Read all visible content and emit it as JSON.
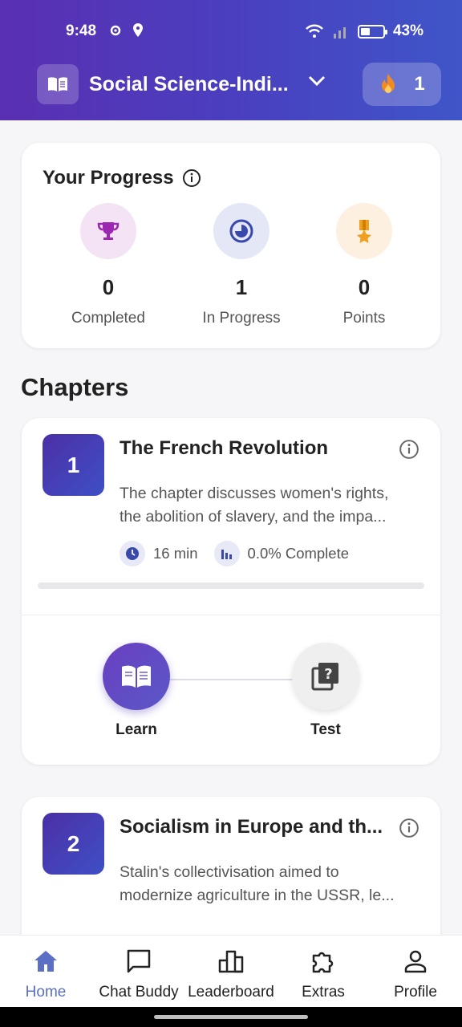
{
  "status_bar": {
    "time": "9:48",
    "battery": "43%"
  },
  "header": {
    "subject_title": "Social Science-Indi...",
    "streak_count": "1"
  },
  "progress": {
    "title": "Your Progress",
    "stats": [
      {
        "value": "0",
        "label": "Completed",
        "icon": "trophy-icon"
      },
      {
        "value": "1",
        "label": "In Progress",
        "icon": "pie-icon"
      },
      {
        "value": "0",
        "label": "Points",
        "icon": "medal-icon"
      }
    ]
  },
  "chapters_heading": "Chapters",
  "chapters": [
    {
      "number": "1",
      "title": "The French Revolution",
      "desc_line1": "The chapter discusses women's rights,",
      "desc_line2": "the abolition of slavery, and the impa...",
      "duration": "16 min",
      "complete_text": "0.0% Complete",
      "progress_fraction": 0.0,
      "steps": {
        "learn": "Learn",
        "test": "Test"
      }
    },
    {
      "number": "2",
      "title": "Socialism in Europe and th...",
      "desc_line1": "Stalin's collectivisation aimed to",
      "desc_line2": "modernize agriculture in the USSR, le..."
    }
  ],
  "nav": [
    {
      "label": "Home",
      "icon": "home-icon",
      "active": true
    },
    {
      "label": "Chat Buddy",
      "icon": "chat-icon"
    },
    {
      "label": "Leaderboard",
      "icon": "leaderboard-icon"
    },
    {
      "label": "Extras",
      "icon": "puzzle-icon"
    },
    {
      "label": "Profile",
      "icon": "person-icon"
    }
  ],
  "colors": {
    "brand_start": "#5a2fb1",
    "brand_end": "#3f55c8",
    "active_nav": "#5b6fc4"
  }
}
